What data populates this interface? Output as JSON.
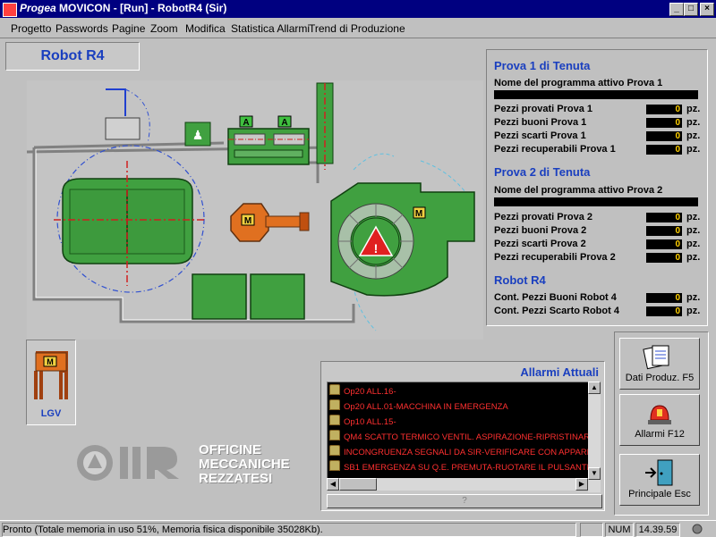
{
  "window": {
    "title_brand": "Progea",
    "title": "MOVICON - [Run] - RobotR4 (Sir)",
    "controls": [
      "_",
      "□",
      "×"
    ]
  },
  "menu": [
    "Progetto",
    "Passwords",
    "Pagine",
    "Zoom",
    "Modifica",
    "Statistica Allarmi",
    "Trend di Produzione"
  ],
  "page_title": "Robot R4",
  "plant": {
    "badge_a1": "A",
    "badge_a2": "A",
    "motor_robot": "M",
    "motor_table": "M",
    "motor_lgv": "M",
    "lgv_label": "LGV"
  },
  "info": {
    "section1": "Prova 1 di Tenuta",
    "prog1_label": "Nome del programma attivo Prova 1",
    "rows1": [
      {
        "label": "Pezzi provati Prova 1",
        "value": "0",
        "unit": "pz."
      },
      {
        "label": "Pezzi buoni Prova 1",
        "value": "0",
        "unit": "pz."
      },
      {
        "label": "Pezzi scarti Prova 1",
        "value": "0",
        "unit": "pz."
      },
      {
        "label": "Pezzi recuperabili Prova 1",
        "value": "0",
        "unit": "pz."
      }
    ],
    "section2": "Prova 2 di Tenuta",
    "prog2_label": "Nome del programma attivo Prova 2",
    "rows2": [
      {
        "label": "Pezzi provati Prova 2",
        "value": "0",
        "unit": "pz."
      },
      {
        "label": "Pezzi buoni Prova 2",
        "value": "0",
        "unit": "pz."
      },
      {
        "label": "Pezzi scarti Prova 2",
        "value": "0",
        "unit": "pz."
      },
      {
        "label": "Pezzi recuperabili Prova 2",
        "value": "0",
        "unit": "pz."
      }
    ],
    "section3": "Robot R4",
    "rows3": [
      {
        "label": "Cont. Pezzi Buoni Robot 4",
        "value": "0",
        "unit": "pz."
      },
      {
        "label": "Cont. Pezzi Scarto Robot 4",
        "value": "0",
        "unit": "pz."
      }
    ]
  },
  "buttons": {
    "production_data": "Dati Produz. F5",
    "alarms": "Allarmi F12",
    "main": "Principale Esc"
  },
  "alarms": {
    "title": "Allarmi Attuali",
    "items": [
      "Op20 ALL.16-",
      "Op20 ALL.01-MACCHINA IN EMERGENZA",
      "Op10 ALL.15-",
      "QM4 SCATTO TERMICO VENTIL. ASPIRAZIONE-RIPRISTINAR...",
      "INCONGRUENZA SEGNALI DA SIR-VERIFICARE CON APPARE...",
      "SB1 EMERGENZA SU Q.E. PREMUTA-RUOTARE IL PULSANTE..."
    ],
    "help": "?"
  },
  "logo": {
    "line1": "OFFICINE",
    "line2": "MECCANICHE",
    "line3": "REZZATESI"
  },
  "status": {
    "message": "Pronto (Totale memoria in uso 51%, Memoria fisica disponibile 35028Kb).",
    "num": "NUM",
    "time": "14.39.59"
  },
  "colors": {
    "machine_green": "#3f9a3f",
    "robot_orange": "#e07020",
    "accent_blue": "#1a3fbf",
    "alarm_red": "#ff3030",
    "value_yellow": "#ffd000"
  }
}
